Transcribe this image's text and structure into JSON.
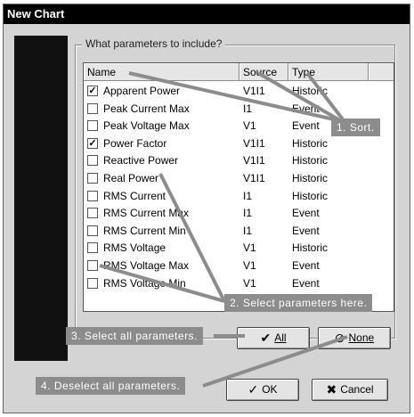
{
  "window": {
    "title": "New Chart"
  },
  "group": {
    "label": "What parameters to include?"
  },
  "columns": {
    "name": "Name",
    "source": "Source",
    "type": "Type"
  },
  "rows": [
    {
      "checked": true,
      "name": "Apparent Power",
      "source": "V1I1",
      "type": "Historic"
    },
    {
      "checked": false,
      "name": "Peak Current Max",
      "source": "I1",
      "type": "Event"
    },
    {
      "checked": false,
      "name": "Peak Voltage Max",
      "source": "V1",
      "type": "Event"
    },
    {
      "checked": true,
      "name": "Power Factor",
      "source": "V1I1",
      "type": "Historic"
    },
    {
      "checked": false,
      "name": "Reactive Power",
      "source": "V1I1",
      "type": "Historic"
    },
    {
      "checked": false,
      "name": "Real Power",
      "source": "V1I1",
      "type": "Historic"
    },
    {
      "checked": false,
      "name": "RMS Current",
      "source": "I1",
      "type": "Historic"
    },
    {
      "checked": false,
      "name": "RMS Current Max",
      "source": "I1",
      "type": "Event"
    },
    {
      "checked": false,
      "name": "RMS Current Min",
      "source": "I1",
      "type": "Event"
    },
    {
      "checked": false,
      "name": "RMS Voltage",
      "source": "V1",
      "type": "Historic"
    },
    {
      "checked": false,
      "name": "RMS Voltage Max",
      "source": "V1",
      "type": "Event"
    },
    {
      "checked": false,
      "name": "RMS Voltage Min",
      "source": "V1",
      "type": "Event"
    }
  ],
  "buttons": {
    "all": "All",
    "none": "None",
    "ok": "OK",
    "cancel": "Cancel"
  },
  "callouts": {
    "sort": "1. Sort.",
    "select_here": "2. Select parameters here.",
    "select_all": "3. Select all parameters.",
    "deselect_all": "4. Deselect all parameters."
  },
  "icons": {
    "check": "check-icon",
    "all": "checkmark-pen-icon",
    "none": "no-symbol-icon",
    "ok": "checkmark-icon",
    "cancel": "x-icon"
  },
  "colors": {
    "titlebar": "#000000",
    "dialog": "#d4d4d4",
    "callout": "#8c8c8c"
  }
}
